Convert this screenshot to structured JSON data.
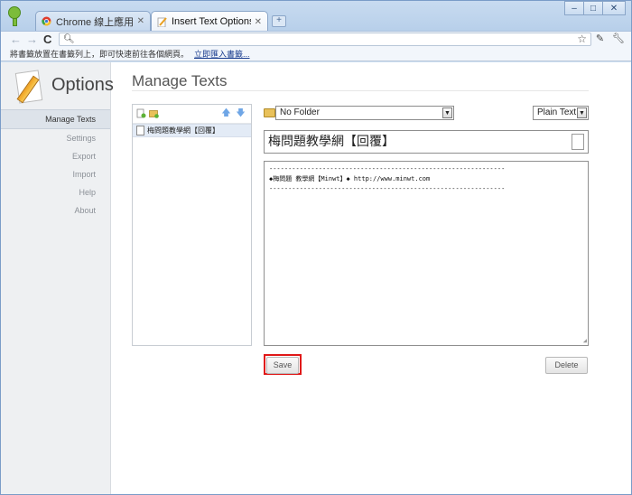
{
  "tabs": [
    {
      "label": "Chrome 線上應用程式商店",
      "active": false
    },
    {
      "label": "Insert Text Options",
      "active": true
    }
  ],
  "window_controls": {
    "minimize": "–",
    "maximize": "□",
    "close": "✕"
  },
  "toolbar": {
    "back": "←",
    "forward": "→",
    "reload": "C",
    "address_value": ""
  },
  "bookmarks_bar": {
    "message": "將書籤放置在書籤列上，即可快速前往各個網頁。",
    "import_link": "立即匯入書籤..."
  },
  "sidebar": {
    "logo_text": "Options",
    "items": [
      {
        "label": "Manage Texts",
        "active": true
      },
      {
        "label": "Settings",
        "active": false
      },
      {
        "label": "Export",
        "active": false
      },
      {
        "label": "Import",
        "active": false
      },
      {
        "label": "Help",
        "active": false
      },
      {
        "label": "About",
        "active": false
      }
    ]
  },
  "main": {
    "title": "Manage Texts",
    "list": {
      "items": [
        {
          "label": "梅問題教學網【回覆】",
          "selected": true
        }
      ]
    },
    "folder_select": {
      "value": "No Folder"
    },
    "format_select": {
      "value": "Plain Text"
    },
    "text_title": "梅問題教學網【回覆】",
    "text_body": "--------------------------------------------------------------\n◆梅問題 教學網【Minwt】◆ http://www.minwt.com\n--------------------------------------------------------------",
    "save_label": "Save",
    "delete_label": "Delete"
  },
  "colors": {
    "highlight_border": "#e01818",
    "selected_row": "#e3ebf6",
    "accent": "#7cbc3a"
  }
}
